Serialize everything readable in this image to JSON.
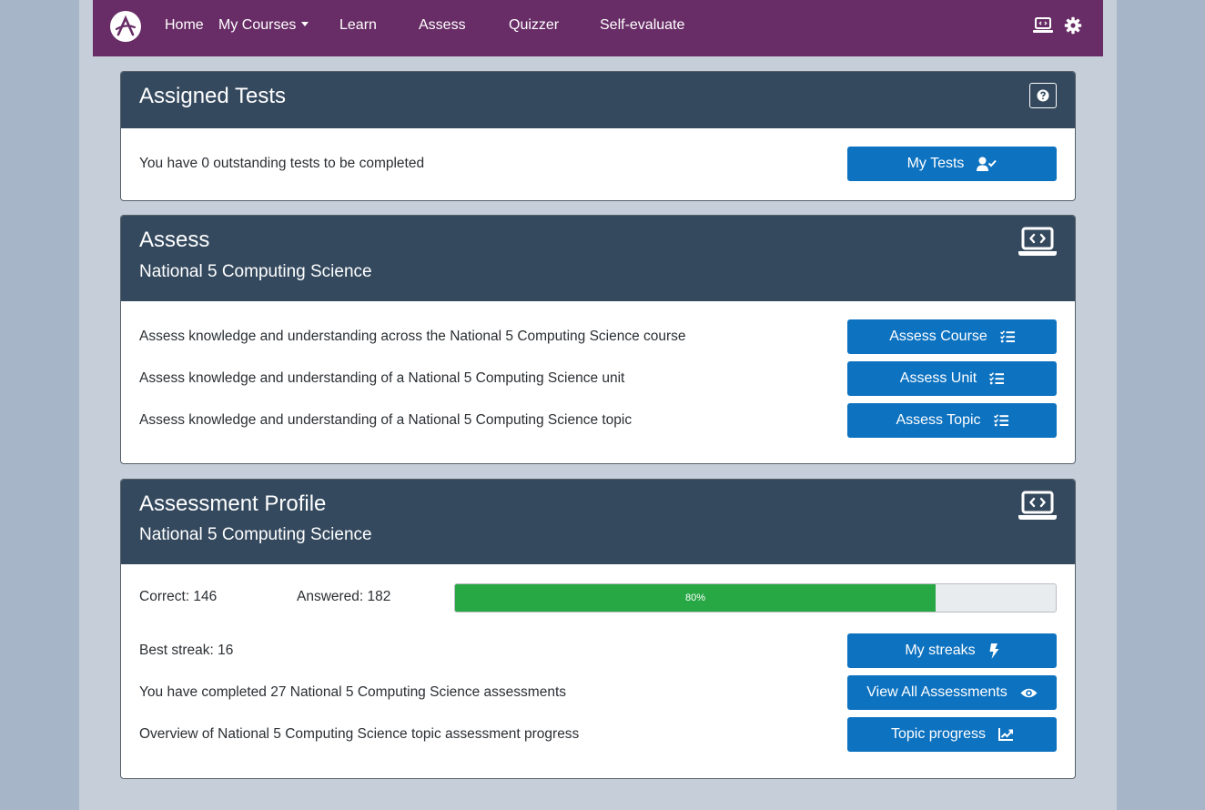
{
  "nav": {
    "items": [
      "Home",
      "My Courses",
      "Learn",
      "Assess",
      "Quizzer",
      "Self-evaluate"
    ]
  },
  "icons": {
    "brand": "logo-icon",
    "laptop": "laptop-code-icon",
    "settings": "gear-icon",
    "help": "question-circle-icon",
    "tests": "user-check-icon",
    "list": "tasks-icon",
    "streak": "bolt-icon",
    "view": "eye-icon",
    "progress": "chart-line-icon"
  },
  "colors": {
    "nav_bg": "#682d66",
    "header_bg": "#34495e",
    "button": "#0d72c0",
    "progress": "#28a745"
  },
  "assigned": {
    "title": "Assigned Tests",
    "text": "You have 0 outstanding tests to be completed",
    "button": "My Tests"
  },
  "assess": {
    "title": "Assess",
    "subtitle": "National 5 Computing Science",
    "rows": [
      {
        "text": "Assess knowledge and understanding across the National 5 Computing Science course",
        "button": "Assess Course"
      },
      {
        "text": "Assess knowledge and understanding of a National 5 Computing Science unit",
        "button": "Assess Unit"
      },
      {
        "text": "Assess knowledge and understanding of a National 5 Computing Science topic",
        "button": "Assess Topic"
      }
    ]
  },
  "profile": {
    "title": "Assessment Profile",
    "subtitle": "National 5 Computing Science",
    "correct": "Correct: 146",
    "answered": "Answered: 182",
    "progress_percent": 80,
    "progress_label": "80%",
    "rows": [
      {
        "text": "Best streak: 16",
        "button": "My streaks"
      },
      {
        "text": "You have completed 27 National 5 Computing Science assessments",
        "button": "View All Assessments"
      },
      {
        "text": "Overview of National 5 Computing Science topic assessment progress",
        "button": "Topic progress"
      }
    ]
  }
}
